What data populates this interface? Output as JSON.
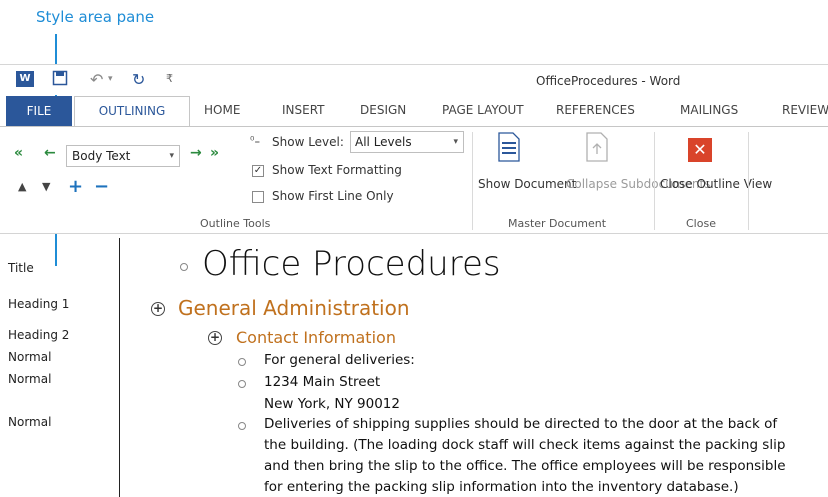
{
  "callout": {
    "text": "Style area pane"
  },
  "window": {
    "title": "OfficeProcedures - Word",
    "app_icon": "word-icon",
    "quick_access": [
      "save-icon",
      "undo-icon",
      "redo-icon",
      "customize-qat-icon"
    ]
  },
  "tabs": [
    {
      "label": "FILE"
    },
    {
      "label": "OUTLINING",
      "active": true
    },
    {
      "label": "HOME"
    },
    {
      "label": "INSERT"
    },
    {
      "label": "DESIGN"
    },
    {
      "label": "PAGE LAYOUT"
    },
    {
      "label": "REFERENCES"
    },
    {
      "label": "MAILINGS"
    },
    {
      "label": "REVIEW"
    }
  ],
  "ribbon": {
    "outline_tools": {
      "group_label": "Outline Tools",
      "style_value": "Body Text",
      "show_level_label": "Show Level:",
      "show_level_value": "All Levels",
      "show_text_formatting": {
        "label": "Show Text Formatting",
        "checked": true
      },
      "show_first_line_only": {
        "label": "Show First Line Only",
        "checked": false
      }
    },
    "master_document": {
      "group_label": "Master Document",
      "show_document": "Show Document",
      "collapse_subdocuments": "Collapse Subdocuments"
    },
    "close": {
      "group_label": "Close",
      "close_outline_view": "Close Outline View"
    }
  },
  "style_area": [
    "Title",
    "Heading 1",
    "Heading 2",
    "Normal",
    "Normal",
    "Normal"
  ],
  "document": {
    "title": "Office Procedures",
    "heading1": "General Administration",
    "heading2": "Contact Information",
    "body": [
      "For general deliveries:",
      "1234 Main Street",
      "New York, NY  90012",
      "Deliveries of shipping supplies should be directed to the door at the back of",
      "the building. (The loading dock staff will check items against the packing slip",
      "and then bring the slip to the office. The office employees will be responsible",
      "for entering the packing slip information into the inventory database.)"
    ]
  },
  "colors": {
    "accent": "#2b579a",
    "callout": "#1f8dd6",
    "heading": "#c0711e",
    "close_button": "#d9442a"
  }
}
